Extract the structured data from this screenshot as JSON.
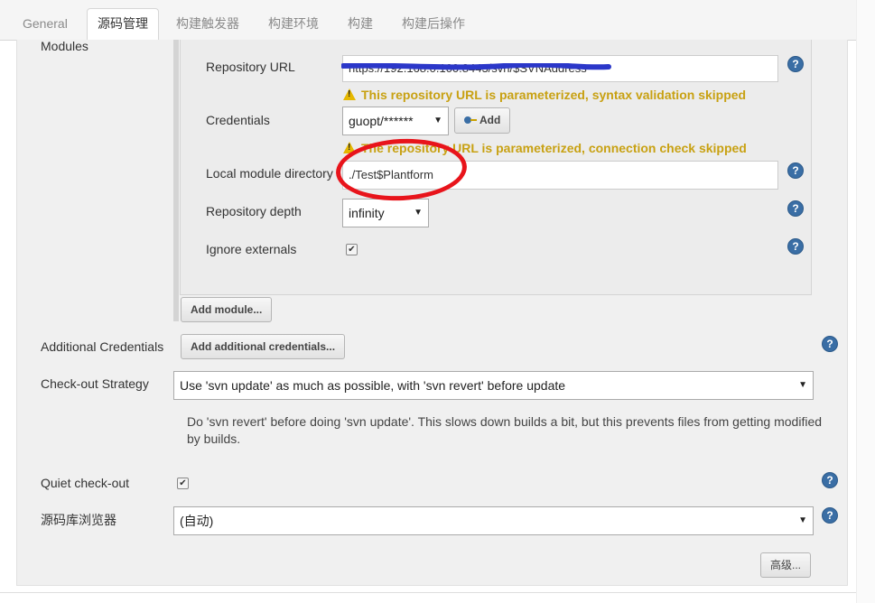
{
  "tabs": [
    {
      "label": "General"
    },
    {
      "label": "源码管理"
    },
    {
      "label": "构建触发器"
    },
    {
      "label": "构建环境"
    },
    {
      "label": "构建"
    },
    {
      "label": "构建后操作"
    }
  ],
  "modules": {
    "label": "Modules",
    "repository_url": {
      "label": "Repository URL",
      "value": "https://192.168.0.100:8443/svn/$SVNAddress"
    },
    "url_warning": "This repository URL is parameterized, syntax validation skipped",
    "credentials": {
      "label": "Credentials",
      "selected": "guopt/******",
      "add_label": "Add"
    },
    "conn_warning": "The repository URL is parameterized, connection check skipped",
    "local_dir": {
      "label": "Local module directory",
      "value": "./Test$Plantform"
    },
    "depth": {
      "label": "Repository depth",
      "selected": "infinity"
    },
    "ignore_externals": {
      "label": "Ignore externals",
      "checked": true
    },
    "add_module_label": "Add module..."
  },
  "additional_credentials": {
    "label": "Additional Credentials",
    "button": "Add additional credentials..."
  },
  "checkout_strategy": {
    "label": "Check-out Strategy",
    "selected": "Use 'svn update' as much as possible, with 'svn revert' before update",
    "description": "Do 'svn revert' before doing 'svn update'. This slows down builds a bit, but this prevents files from getting modified by builds."
  },
  "quiet_checkout": {
    "label": "Quiet check-out",
    "checked": true
  },
  "repo_browser": {
    "label": "源码库浏览器",
    "selected": "(自动)"
  },
  "advanced_label": "高级...",
  "icons": {
    "help": "?",
    "check": "✔",
    "dropdown": "▼"
  },
  "colors": {
    "warning": "#c8a112",
    "help": "#3a6ea5",
    "annotation": "#e8141b",
    "scribble": "#2b37c9"
  }
}
